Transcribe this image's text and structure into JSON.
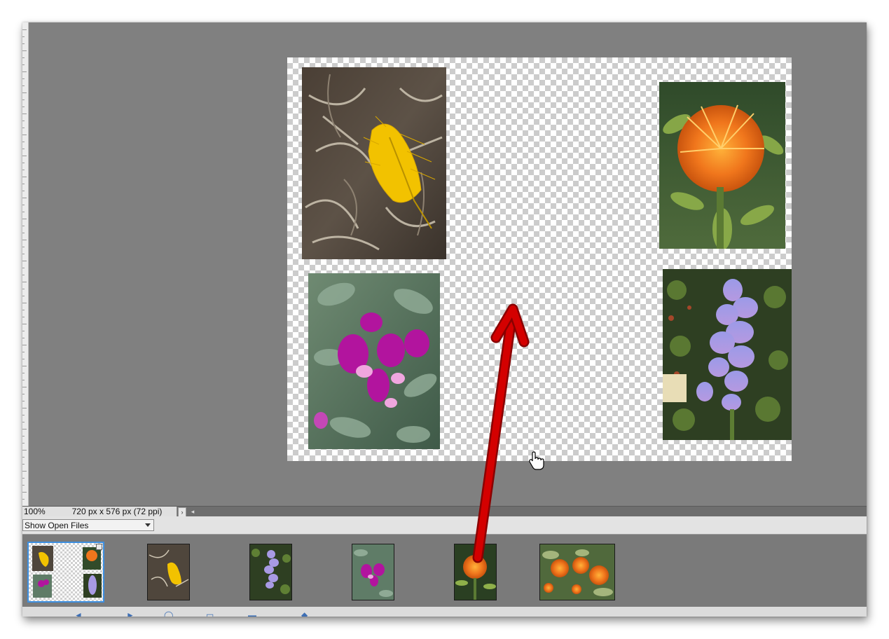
{
  "status_bar": {
    "zoom": "100%",
    "doc_info": "720 px x 576 px (72 ppi)",
    "info_arrow": "›",
    "scroll_left": "◂"
  },
  "photo_bin": {
    "dropdown_value": "Show Open Files",
    "thumbnails": [
      {
        "name": "composite-layout",
        "selected": true
      },
      {
        "name": "yellow-leaf"
      },
      {
        "name": "lavender-delphinium"
      },
      {
        "name": "magenta-sweetpea"
      },
      {
        "name": "orange-pincushion"
      },
      {
        "name": "orange-pincushion-cluster"
      }
    ]
  },
  "canvas": {
    "photos": [
      "yellow-leaf",
      "orange-pincushion",
      "magenta-sweetpea",
      "lavender-delphinium"
    ]
  },
  "colors": {
    "annotation_arrow": "#d40000",
    "selection_border": "#3d8fe0",
    "workspace_gray": "#808080"
  },
  "icons": {
    "cursor": "hand-pointer-icon",
    "annotation": "red-arrow-icon"
  }
}
